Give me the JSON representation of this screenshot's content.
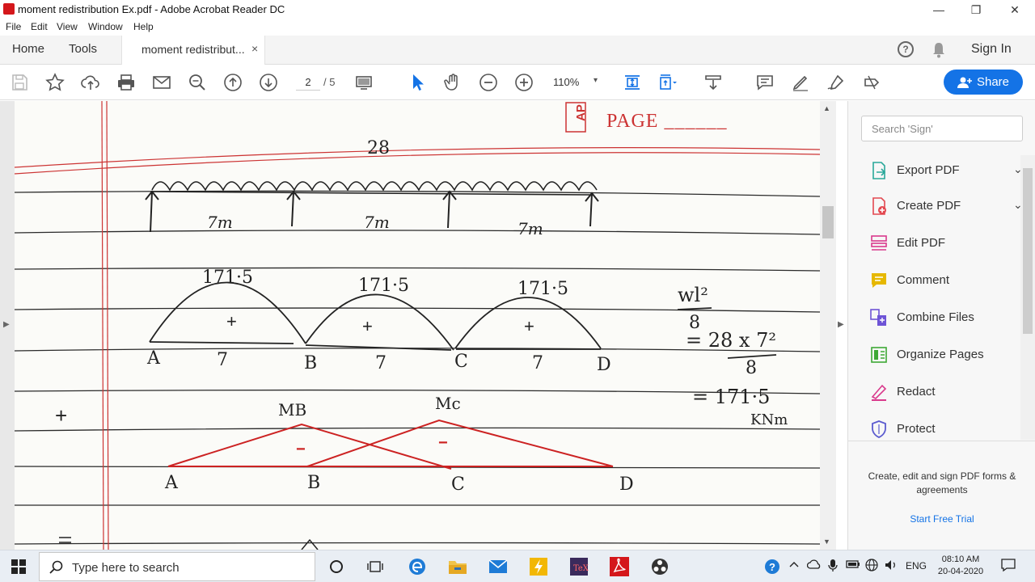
{
  "window": {
    "title": "moment redistribution Ex.pdf - Adobe Acrobat Reader DC",
    "minimize": "—",
    "restore": "❐",
    "close": "✕"
  },
  "menu": [
    "File",
    "Edit",
    "View",
    "Window",
    "Help"
  ],
  "tabs": {
    "home": "Home",
    "tools": "Tools",
    "document": "moment redistribut...",
    "close": "×"
  },
  "header": {
    "help": "?",
    "signin": "Sign In"
  },
  "toolbar": {
    "page_current": "2",
    "page_total": "/ 5",
    "zoom": "110%",
    "zoom_caret": "▾",
    "share": "Share"
  },
  "accent_color": "#1473e6",
  "document": {
    "header_stamp": "AP",
    "header_text": "PAGE ______",
    "load": "28",
    "span1": "7m",
    "span2": "7m",
    "span3": "7m",
    "moment1": "171·5",
    "moment2": "171·5",
    "moment3": "171·5",
    "sign1": "+",
    "sign2": "+",
    "sign3": "+",
    "sagging_labels": [
      "A",
      "7",
      "B",
      "7",
      "C",
      "7",
      "D"
    ],
    "formula_top": "wl²",
    "formula_bottom": "8",
    "formula_eq": "= 28 x 7²",
    "formula_eq_den": "8",
    "formula_result": "= 171·5",
    "formula_unit": "KNm",
    "left_plus": "+",
    "mb": "MB",
    "mc": "Mc",
    "minus1": "−",
    "minus2": "−",
    "hogging_labels": [
      "A",
      "B",
      "C",
      "D"
    ]
  },
  "rightpane": {
    "search_placeholder": "Search 'Sign'",
    "tools": [
      {
        "label": "Export PDF",
        "icon": "export-pdf-icon",
        "chevron": "⌄",
        "color": "#2aa89a"
      },
      {
        "label": "Create PDF",
        "icon": "create-pdf-icon",
        "chevron": "⌄",
        "color": "#e34850"
      },
      {
        "label": "Edit PDF",
        "icon": "edit-pdf-icon",
        "color": "#d9398c"
      },
      {
        "label": "Comment",
        "icon": "comment-icon",
        "color": "#e6b800"
      },
      {
        "label": "Combine Files",
        "icon": "combine-files-icon",
        "color": "#6e54d6"
      },
      {
        "label": "Organize Pages",
        "icon": "organize-pages-icon",
        "color": "#3ea835"
      },
      {
        "label": "Redact",
        "icon": "redact-icon",
        "color": "#d9398c"
      },
      {
        "label": "Protect",
        "icon": "protect-icon",
        "color": "#5b5bcf"
      }
    ],
    "promo": "Create, edit and sign PDF forms & agreements",
    "trial": "Start Free Trial"
  },
  "taskbar": {
    "search": "Type here to search",
    "lang": "ENG",
    "time": "08:10 AM",
    "date": "20-04-2020"
  }
}
